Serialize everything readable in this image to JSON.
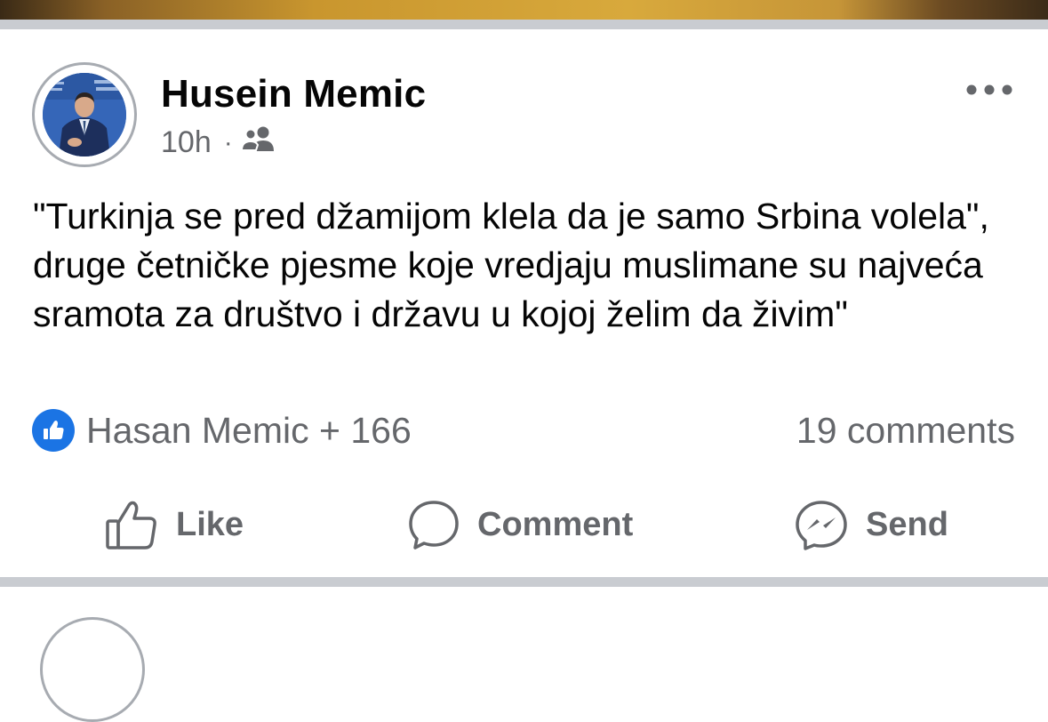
{
  "post": {
    "author": "Husein Memic",
    "time": "10h",
    "separator": "·",
    "audience_icon": "friends-icon",
    "text": "\"Turkinja se pred džamijom klela da je samo Srbina volela\", druge četničke pjesme koje vredjaju muslimane su najveća sramota za društvo i državu u kojoj želim da živim\"",
    "reactions": {
      "icon": "like-icon",
      "label": "Hasan Memic + 166"
    },
    "comments_label": "19 comments"
  },
  "actions": {
    "like": "Like",
    "comment": "Comment",
    "send": "Send"
  },
  "colors": {
    "accent": "#1b74e4",
    "text_primary": "#050505",
    "text_secondary": "#65676b",
    "separator": "#c9ccd1"
  }
}
